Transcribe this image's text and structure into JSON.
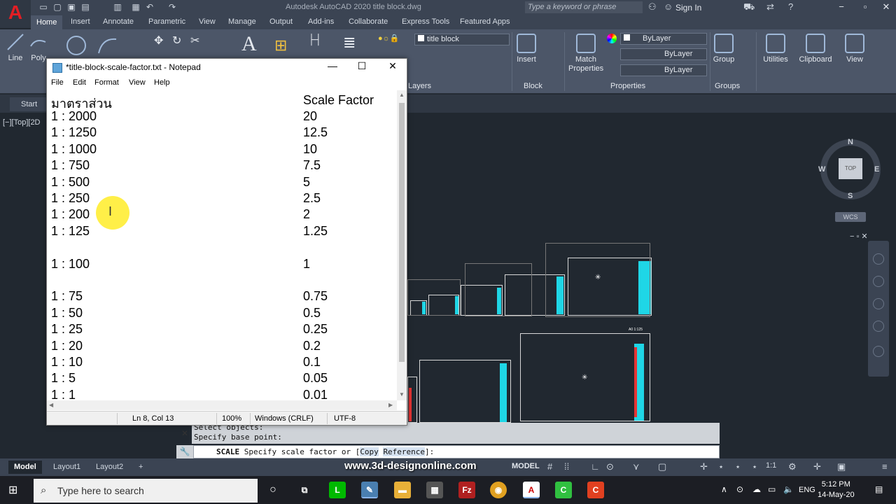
{
  "acad": {
    "title": "Autodesk AutoCAD 2020   title block.dwg",
    "search_placeholder": "Type a keyword or phrase",
    "sign_in": "Sign In",
    "tabs": [
      "Home",
      "Insert",
      "Annotate",
      "Parametric",
      "View",
      "Manage",
      "Output",
      "Add-ins",
      "Collaborate",
      "Express Tools",
      "Featured Apps"
    ],
    "draw_tools": {
      "line": "Line",
      "polyline": "Poly"
    },
    "layer_name": "title block",
    "layers_label": "Layers",
    "insert_label": "Insert",
    "block_label": "Block",
    "match_properties": "Match Properties",
    "properties_label": "Properties",
    "bylayer": [
      "ByLayer",
      "ByLayer",
      "ByLayer"
    ],
    "group_label": "Group",
    "groups_label": "Groups",
    "utilities": "Utilities",
    "clipboard": "Clipboard",
    "view": "View",
    "file_tab_start": "Start",
    "viewport_label": "[−][Top][2D",
    "compass": {
      "n": "N",
      "s": "S",
      "e": "E",
      "w": "W",
      "top": "TOP"
    },
    "wcs": "WCS",
    "frame_labels": [
      "A0 1:125"
    ],
    "command_history": [
      "Select objects:",
      "Specify base point:"
    ],
    "command": {
      "name": "SCALE",
      "prompt": " Specify scale factor or [",
      "opt1": "Copy",
      "opt2": "Reference",
      "end": "]:"
    },
    "layout_tabs": [
      "Model",
      "Layout1",
      "Layout2"
    ],
    "status_model": "MODEL",
    "scale_readout": "1:1",
    "watermark": "www.3d-designonline.com"
  },
  "notepad": {
    "title": "*title-block-scale-factor.txt - Notepad",
    "menu": [
      "File",
      "Edit",
      "Format",
      "View",
      "Help"
    ],
    "header": {
      "col1": "มาตราส่วน",
      "col2": "Scale Factor"
    },
    "rows": [
      {
        "scale": "1 : 2000",
        "factor": "20"
      },
      {
        "scale": "1 : 1250",
        "factor": "12.5"
      },
      {
        "scale": "1 : 1000",
        "factor": "10"
      },
      {
        "scale": "1 : 750",
        "factor": "7.5"
      },
      {
        "scale": "1 : 500",
        "factor": "5"
      },
      {
        "scale": "1 : 250",
        "factor": "2.5"
      },
      {
        "scale": "1 : 200",
        "factor": "2"
      },
      {
        "scale": "1 : 125",
        "factor": "1.25"
      },
      {
        "scale": "",
        "factor": ""
      },
      {
        "scale": "1 : 100",
        "factor": "1"
      },
      {
        "scale": "",
        "factor": ""
      },
      {
        "scale": "1 : 75",
        "factor": "0.75"
      },
      {
        "scale": "1 : 50",
        "factor": "0.5"
      },
      {
        "scale": "1 : 25",
        "factor": "0.25"
      },
      {
        "scale": "1 : 20",
        "factor": "0.2"
      },
      {
        "scale": "1 : 10",
        "factor": "0.1"
      },
      {
        "scale": "1 : 5",
        "factor": "0.05"
      },
      {
        "scale": "1 : 1",
        "factor": "0.01"
      }
    ],
    "status": {
      "position": "Ln 8, Col 13",
      "zoom": "100%",
      "line_ending": "Windows (CRLF)",
      "encoding": "UTF-8"
    }
  },
  "taskbar": {
    "search_placeholder": "Type here to search",
    "lang": "ENG",
    "time": "5:12 PM",
    "date": "14-May-20"
  },
  "colors": {
    "accent_cyan": "#1fd6e6",
    "accent_red": "#e43333",
    "cursor_highlight": "#ffec28"
  }
}
